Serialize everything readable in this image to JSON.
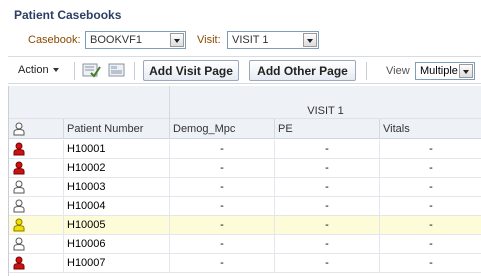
{
  "title": "Patient Casebooks",
  "filters": {
    "casebook_label": "Casebook:",
    "casebook_value": "BOOKVF1",
    "visit_label": "Visit:",
    "visit_value": "VISIT 1"
  },
  "toolbar": {
    "action_label": "Action",
    "add_visit_label": "Add Visit Page",
    "add_other_label": "Add Other Page",
    "view_label": "View",
    "view_value": "Multiple"
  },
  "grid": {
    "visit_header": "VISIT 1",
    "columns": [
      "Patient Number",
      "Demog_Mpc",
      "PE",
      "Vitals"
    ],
    "rows": [
      {
        "patient": "H10001",
        "status": "red",
        "demog": "-",
        "pe": "-",
        "vitals": "-"
      },
      {
        "patient": "H10002",
        "status": "red",
        "demog": "-",
        "pe": "-",
        "vitals": "-"
      },
      {
        "patient": "H10003",
        "status": "white",
        "demog": "-",
        "pe": "-",
        "vitals": "-"
      },
      {
        "patient": "H10004",
        "status": "white",
        "demog": "-",
        "pe": "-",
        "vitals": "-"
      },
      {
        "patient": "H10005",
        "status": "yellow",
        "demog": "-",
        "pe": "-",
        "vitals": "-"
      },
      {
        "patient": "H10006",
        "status": "white",
        "demog": "-",
        "pe": "-",
        "vitals": "-"
      },
      {
        "patient": "H10007",
        "status": "red",
        "demog": "-",
        "pe": "-",
        "vitals": "-"
      }
    ]
  },
  "colors": {
    "red": "#cc1111",
    "white": "#ffffff",
    "yellow": "#f2e000",
    "highlight_row": "#fefbd8",
    "title": "#2a3f63"
  },
  "icons": {
    "patient_status": "person-icon",
    "header": "person-outline-icon"
  }
}
